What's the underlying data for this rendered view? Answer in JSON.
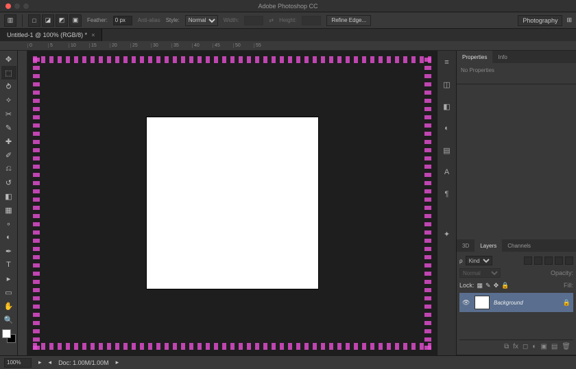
{
  "app": {
    "title": "Adobe Photoshop CC"
  },
  "workspace": {
    "current": "Photography"
  },
  "options": {
    "feather_label": "Feather:",
    "feather_value": "0 px",
    "antialias_label": "Anti-alias",
    "style_label": "Style:",
    "style_value": "Normal",
    "width_label": "Width:",
    "height_label": "Height:",
    "refine": "Refine Edge..."
  },
  "document": {
    "tab_title": "Untitled-1 @ 100% (RGB/8) *"
  },
  "ruler": {
    "marks": [
      "0",
      "5",
      "10",
      "15",
      "20",
      "25",
      "30",
      "35",
      "40",
      "45",
      "50",
      "55"
    ]
  },
  "panels": {
    "properties": {
      "tab_props": "Properties",
      "tab_info": "Info",
      "body": "No Properties"
    },
    "layers": {
      "tab_3d": "3D",
      "tab_layers": "Layers",
      "tab_channels": "Channels",
      "kind_label": "Kind",
      "blend_value": "Normal",
      "opacity_label": "Opacity:",
      "lock_label": "Lock:",
      "fill_label": "Fill:",
      "layer_name": "Background"
    }
  },
  "status": {
    "zoom": "100%",
    "doc": "Doc: 1.00M/1.00M"
  }
}
